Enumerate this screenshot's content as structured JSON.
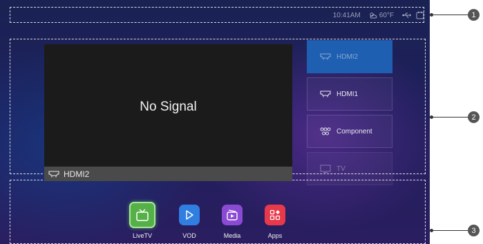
{
  "status_bar": {
    "time": "10:41AM",
    "weather": "60°F",
    "icons": [
      "usb-icon",
      "cast-icon"
    ]
  },
  "preview": {
    "message": "No Signal",
    "current_source": "HDMI2",
    "source_icon": "hdmi-icon"
  },
  "sources": [
    {
      "label": "HDMI2",
      "icon": "hdmi-icon",
      "state": "selected"
    },
    {
      "label": "HDMI1",
      "icon": "hdmi-icon",
      "state": "normal"
    },
    {
      "label": "Component",
      "icon": "component-icon",
      "state": "normal"
    },
    {
      "label": "TV",
      "icon": "tv-icon",
      "state": "faded"
    }
  ],
  "dock": [
    {
      "label": "LiveTV",
      "color": "#55b047",
      "icon": "livetv-icon",
      "active": true
    },
    {
      "label": "VOD",
      "color": "#2f7ee0",
      "icon": "play-icon"
    },
    {
      "label": "Media",
      "color": "#8a4ad3",
      "icon": "media-icon"
    },
    {
      "label": "Apps",
      "color": "#e8394b",
      "icon": "apps-icon"
    }
  ],
  "callouts": [
    "1",
    "2",
    "3"
  ]
}
